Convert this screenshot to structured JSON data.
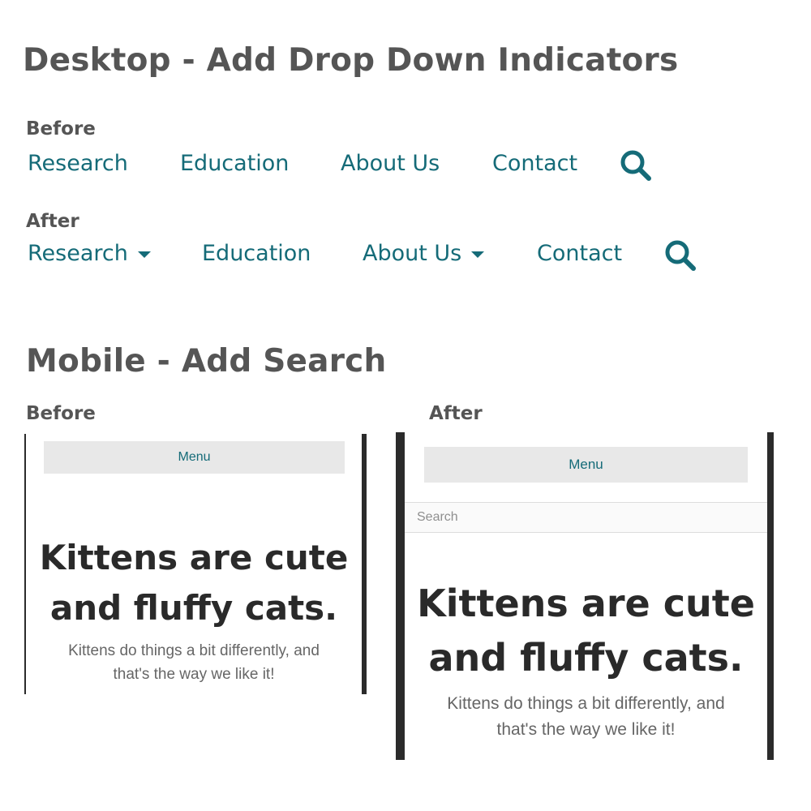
{
  "desktop": {
    "heading": "Desktop - Add Drop Down Indicators",
    "before": {
      "label": "Before",
      "nav": [
        {
          "label": "Research",
          "dropdown": false
        },
        {
          "label": "Education",
          "dropdown": false
        },
        {
          "label": "About Us",
          "dropdown": false
        },
        {
          "label": "Contact",
          "dropdown": false
        }
      ],
      "search_icon": "search-icon"
    },
    "after": {
      "label": "After",
      "nav": [
        {
          "label": "Research",
          "dropdown": true
        },
        {
          "label": "Education",
          "dropdown": false
        },
        {
          "label": "About Us",
          "dropdown": true
        },
        {
          "label": "Contact",
          "dropdown": false
        }
      ],
      "search_icon": "search-icon"
    }
  },
  "mobile": {
    "heading": "Mobile - Add Search",
    "before": {
      "label": "Before",
      "menu_label": "Menu",
      "hero_line1": "Kittens are cute",
      "hero_line2": "and fluffy cats.",
      "sub_line1": "Kittens do things a bit differently, and",
      "sub_line2": "that's the way we like it!"
    },
    "after": {
      "label": "After",
      "menu_label": "Menu",
      "search_placeholder": "Search",
      "hero_line1": "Kittens are cute",
      "hero_line2": "and fluffy cats.",
      "sub_line1": "Kittens do things a bit differently, and",
      "sub_line2": "that's the way we like it!"
    }
  },
  "colors": {
    "accent": "#156b78",
    "heading": "#555555",
    "menu_bg": "#e8e8e8",
    "frame": "#2b2b2b"
  }
}
